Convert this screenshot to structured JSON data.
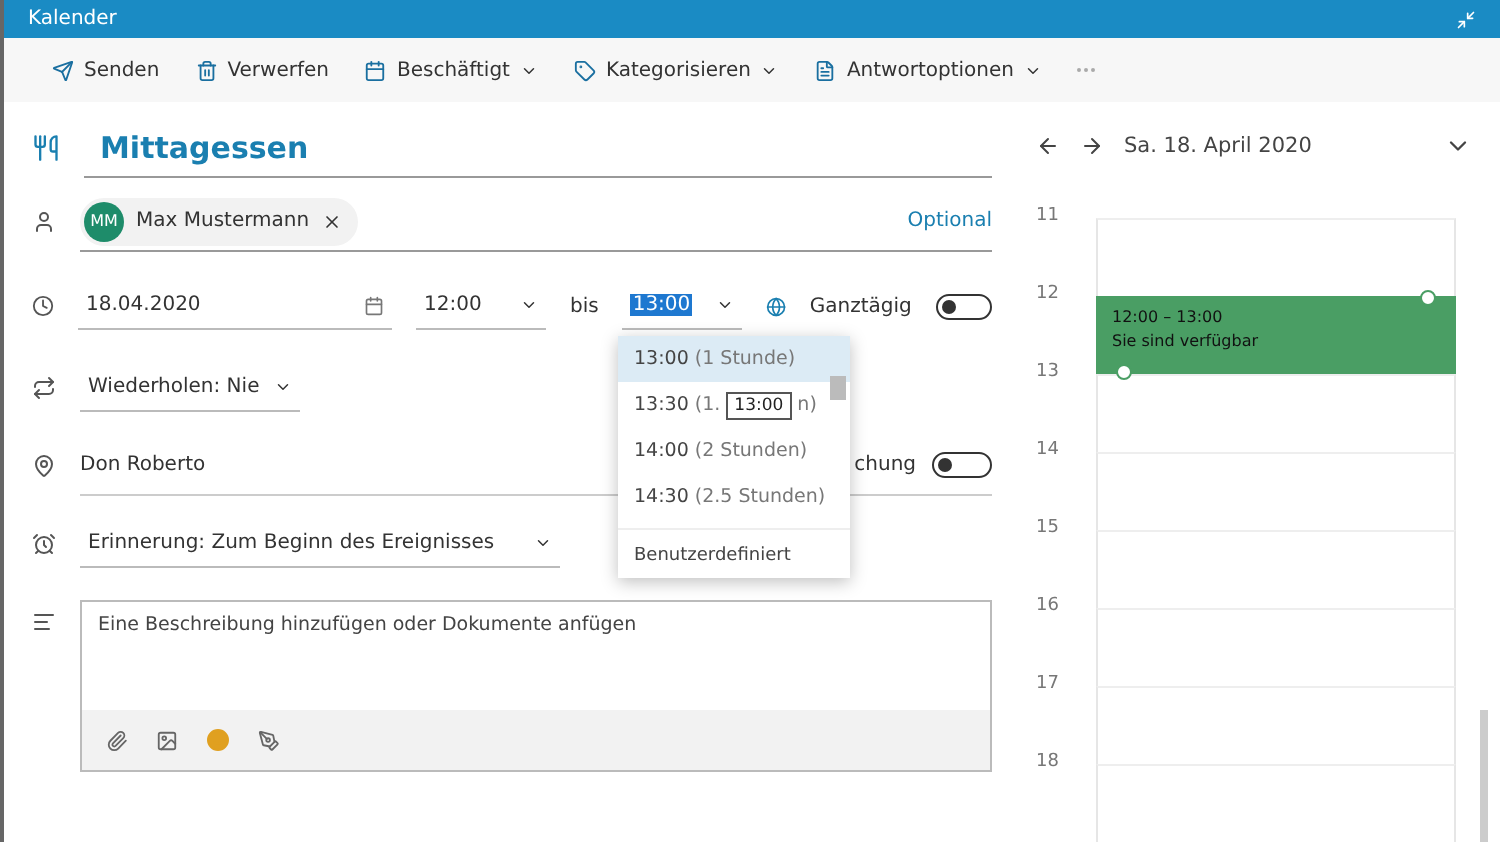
{
  "window": {
    "title": "Kalender"
  },
  "toolbar": [
    {
      "label": "Senden",
      "kind": "send",
      "dropdown": false
    },
    {
      "label": "Verwerfen",
      "kind": "discard",
      "dropdown": false
    },
    {
      "label": "Beschäftigt",
      "kind": "busy",
      "dropdown": true
    },
    {
      "label": "Kategorisieren",
      "kind": "tag",
      "dropdown": true
    },
    {
      "label": "Antwortoptionen",
      "kind": "reply",
      "dropdown": true
    }
  ],
  "form": {
    "title": "Mittagessen",
    "attendees": [
      {
        "initials": "MM",
        "name": "Max Mustermann"
      }
    ],
    "optional": "Optional",
    "date": "18.04.2020",
    "start": "12:00",
    "until": "bis",
    "end": "13:00",
    "all_day": {
      "label": "Ganztägig",
      "on": false
    },
    "repeat": "Wiederholen: Nie",
    "location": "Don Roberto",
    "online": {
      "label": "chung",
      "on": false
    },
    "reminder": "Erinnerung: Zum Beginn des Ereignisses",
    "description": {
      "placeholder": "Eine Beschreibung hinzufügen oder Dokumente anfügen"
    }
  },
  "end_dropdown": {
    "options": [
      {
        "time": "13:00",
        "duration": "(1 Stunde)",
        "selected": true
      },
      {
        "time": "13:30",
        "duration": "(1.",
        "tail": "n)",
        "selected": false
      },
      {
        "time": "14:00",
        "duration": "(2 Stunden)",
        "selected": false
      },
      {
        "time": "14:30",
        "duration": "(2.5 Stunden)",
        "selected": false
      }
    ],
    "custom": "Benutzerdefiniert",
    "tooltip": "13:00"
  },
  "calendar": {
    "date": "Sa. 18. April 2020",
    "hours": [
      "11",
      "12",
      "13",
      "14",
      "15",
      "16",
      "17",
      "18"
    ],
    "event": {
      "time": "12:00 – 13:00",
      "status": "Sie sind verfügbar",
      "color": "#4a9e64"
    }
  }
}
